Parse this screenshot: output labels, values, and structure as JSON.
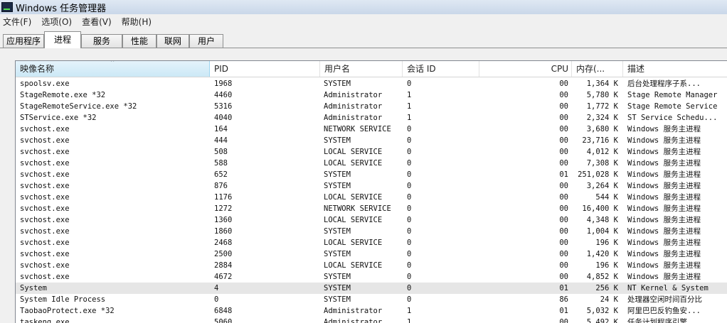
{
  "window": {
    "title": "Windows 任务管理器"
  },
  "menu": [
    "文件(F)",
    "选项(O)",
    "查看(V)",
    "帮助(H)"
  ],
  "tabs": [
    {
      "label": "应用程序",
      "active": false
    },
    {
      "label": "进程",
      "active": true
    },
    {
      "label": "服务",
      "active": false
    },
    {
      "label": "性能",
      "active": false
    },
    {
      "label": "联网",
      "active": false
    },
    {
      "label": "用户",
      "active": false
    }
  ],
  "columns": {
    "name": "映像名称",
    "pid": "PID",
    "user": "用户名",
    "session": "会话 ID",
    "cpu": "CPU",
    "mem": "内存(...",
    "desc": "描述"
  },
  "sort_indicator": "^",
  "rows": [
    [
      "spoolsv.exe",
      "1968",
      "SYSTEM",
      "0",
      "00",
      "1,364 K",
      "后台处理程序子系..."
    ],
    [
      "StageRemote.exe *32",
      "4460",
      "Administrator",
      "1",
      "00",
      "5,780 K",
      "Stage Remote Manager"
    ],
    [
      "StageRemoteService.exe *32",
      "5316",
      "Administrator",
      "1",
      "00",
      "1,772 K",
      "Stage Remote Service"
    ],
    [
      "STService.exe *32",
      "4040",
      "Administrator",
      "1",
      "00",
      "2,324 K",
      "ST Service Schedu..."
    ],
    [
      "svchost.exe",
      "164",
      "NETWORK SERVICE",
      "0",
      "00",
      "3,680 K",
      "Windows 服务主进程"
    ],
    [
      "svchost.exe",
      "444",
      "SYSTEM",
      "0",
      "00",
      "23,716 K",
      "Windows 服务主进程"
    ],
    [
      "svchost.exe",
      "508",
      "LOCAL SERVICE",
      "0",
      "00",
      "4,012 K",
      "Windows 服务主进程"
    ],
    [
      "svchost.exe",
      "588",
      "LOCAL SERVICE",
      "0",
      "00",
      "7,308 K",
      "Windows 服务主进程"
    ],
    [
      "svchost.exe",
      "652",
      "SYSTEM",
      "0",
      "01",
      "251,028 K",
      "Windows 服务主进程"
    ],
    [
      "svchost.exe",
      "876",
      "SYSTEM",
      "0",
      "00",
      "3,264 K",
      "Windows 服务主进程"
    ],
    [
      "svchost.exe",
      "1176",
      "LOCAL SERVICE",
      "0",
      "00",
      "544 K",
      "Windows 服务主进程"
    ],
    [
      "svchost.exe",
      "1272",
      "NETWORK SERVICE",
      "0",
      "00",
      "16,400 K",
      "Windows 服务主进程"
    ],
    [
      "svchost.exe",
      "1360",
      "LOCAL SERVICE",
      "0",
      "00",
      "4,348 K",
      "Windows 服务主进程"
    ],
    [
      "svchost.exe",
      "1860",
      "SYSTEM",
      "0",
      "00",
      "1,004 K",
      "Windows 服务主进程"
    ],
    [
      "svchost.exe",
      "2468",
      "LOCAL SERVICE",
      "0",
      "00",
      "196 K",
      "Windows 服务主进程"
    ],
    [
      "svchost.exe",
      "2500",
      "SYSTEM",
      "0",
      "00",
      "1,420 K",
      "Windows 服务主进程"
    ],
    [
      "svchost.exe",
      "2884",
      "LOCAL SERVICE",
      "0",
      "00",
      "196 K",
      "Windows 服务主进程"
    ],
    [
      "svchost.exe",
      "4672",
      "SYSTEM",
      "0",
      "00",
      "4,852 K",
      "Windows 服务主进程"
    ],
    [
      "System",
      "4",
      "SYSTEM",
      "0",
      "01",
      "256 K",
      "NT Kernel & System"
    ],
    [
      "System Idle Process",
      "0",
      "SYSTEM",
      "0",
      "86",
      "24 K",
      "处理器空闲时间百分比"
    ],
    [
      "TaobaoProtect.exe *32",
      "6848",
      "Administrator",
      "1",
      "01",
      "5,032 K",
      "阿里巴巴反钓鱼安..."
    ],
    [
      "taskeng.exe",
      "5060",
      "Administrator",
      "1",
      "00",
      "5,492 K",
      "任务计划程序引擎"
    ]
  ],
  "selected_row": 18
}
